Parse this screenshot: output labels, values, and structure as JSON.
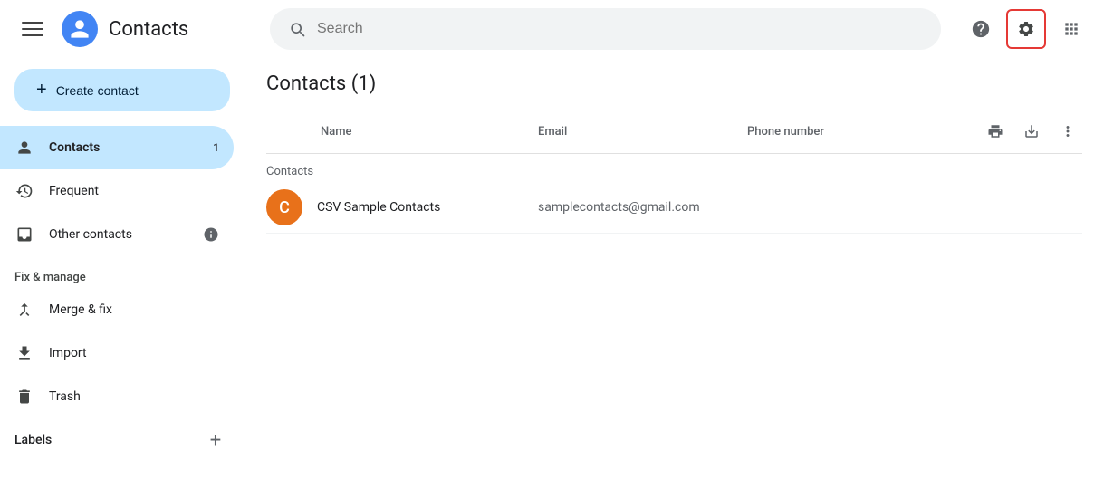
{
  "app": {
    "title": "Contacts"
  },
  "topbar": {
    "search_placeholder": "Search",
    "help_icon": "help-circle-icon",
    "settings_icon": "gear-icon",
    "grid_icon": "grid-icon"
  },
  "sidebar": {
    "create_button_label": "Create contact",
    "nav_items": [
      {
        "id": "contacts",
        "label": "Contacts",
        "badge": "1",
        "active": true
      },
      {
        "id": "frequent",
        "label": "Frequent",
        "badge": "",
        "active": false
      },
      {
        "id": "other-contacts",
        "label": "Other contacts",
        "badge": "",
        "active": false,
        "info": true
      }
    ],
    "fix_manage_header": "Fix & manage",
    "fix_manage_items": [
      {
        "id": "merge-fix",
        "label": "Merge & fix"
      },
      {
        "id": "import",
        "label": "Import"
      },
      {
        "id": "trash",
        "label": "Trash"
      }
    ],
    "labels_header": "Labels",
    "labels_add_icon": "plus-icon"
  },
  "content": {
    "title": "Contacts",
    "count": "(1)",
    "columns": {
      "name": "Name",
      "email": "Email",
      "phone": "Phone number"
    },
    "group_label": "Contacts",
    "contacts": [
      {
        "id": "csv-sample",
        "avatar_letter": "C",
        "avatar_color": "#e8711a",
        "name": "CSV Sample Contacts",
        "email": "samplecontacts@gmail.com",
        "phone": ""
      }
    ]
  }
}
